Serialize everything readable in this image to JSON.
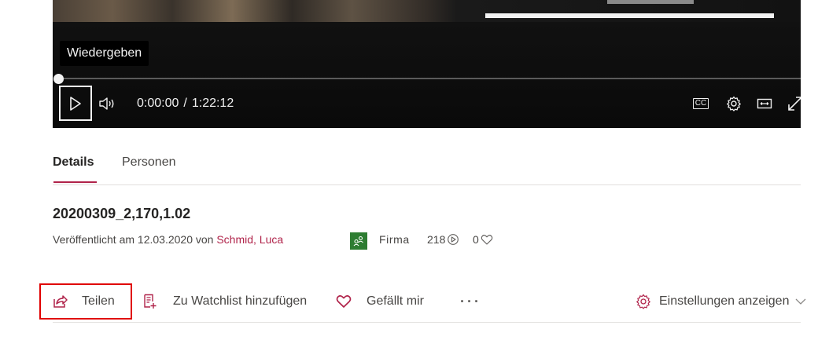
{
  "player": {
    "tooltip": "Wiedergeben",
    "current_time": "0:00:00",
    "separator": "/",
    "duration": "1:22:12",
    "progress_fraction": 0,
    "cc_label": "CC",
    "icons": [
      "play-icon",
      "volume-icon",
      "closed-captions-icon",
      "settings-gear-icon",
      "theater-mode-icon",
      "fullscreen-icon"
    ]
  },
  "tabs": [
    {
      "label": "Details",
      "selected": true
    },
    {
      "label": "Personen",
      "selected": false
    }
  ],
  "video": {
    "title": "20200309_2,170,1.02",
    "published_prefix": "Veröffentlicht am 12.03.2020 von ",
    "author": "Schmid, Luca",
    "group_label": "Firma",
    "views": "218",
    "likes": "0"
  },
  "actions": {
    "share": "Teilen",
    "watchlist": "Zu Watchlist hinzufügen",
    "like": "Gefällt mir",
    "more": "···",
    "settings": "Einstellungen anzeigen"
  },
  "colors": {
    "accent": "#b0234a",
    "highlight_outline": "#e00000",
    "group_badge": "#2e7d32",
    "player_bg": "#0d0d0d"
  }
}
